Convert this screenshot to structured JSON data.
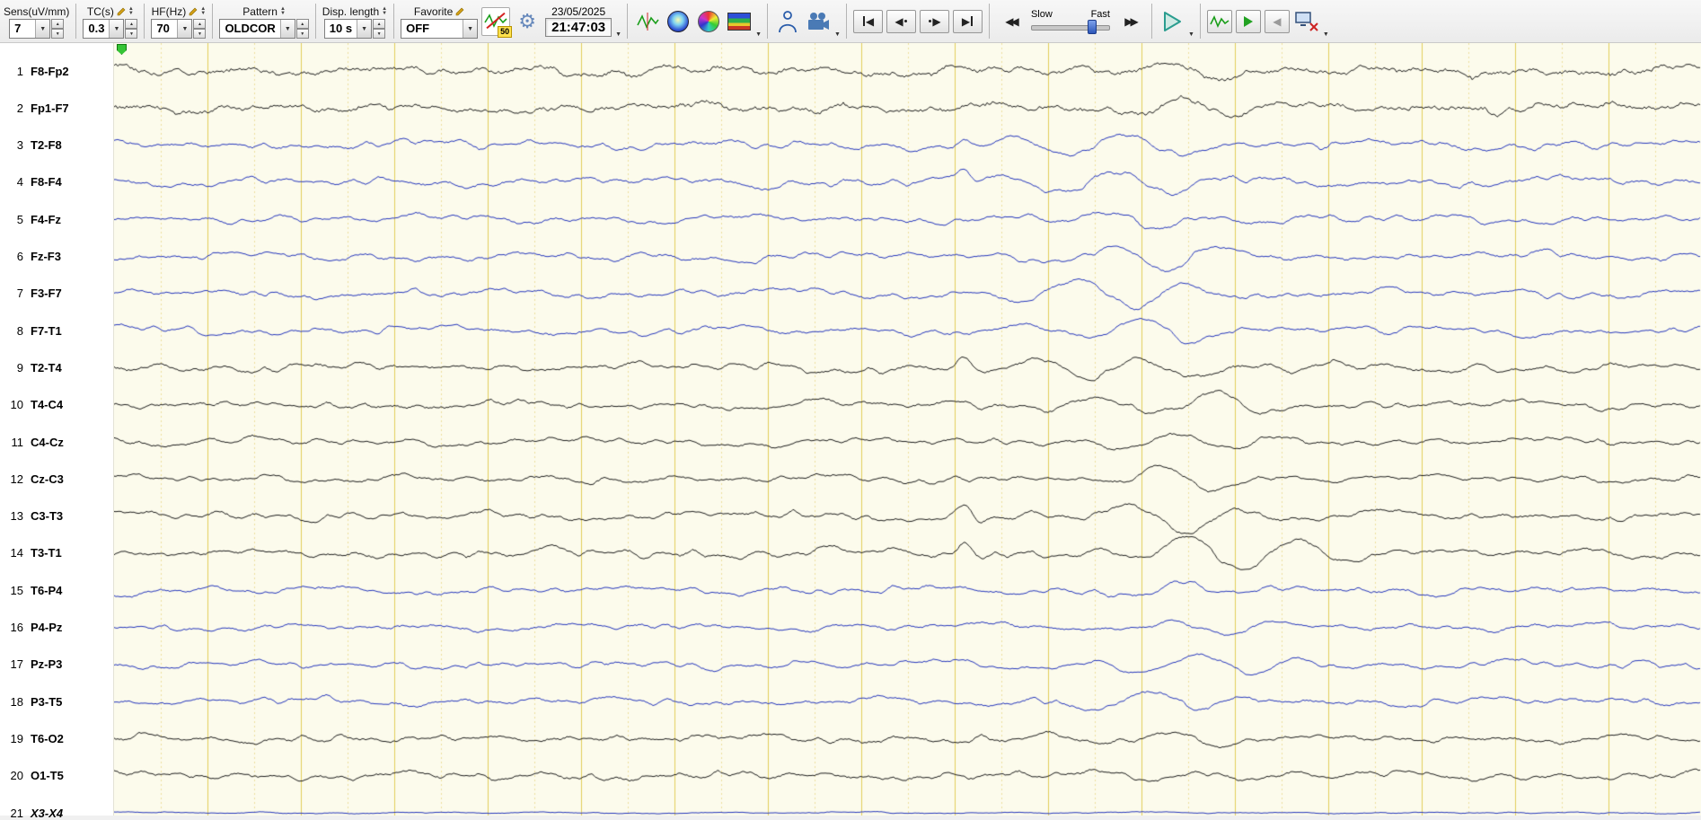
{
  "toolbar": {
    "groups": [
      {
        "label": "Sens(uV/mm)",
        "value": "7"
      },
      {
        "label": "TC(s)",
        "value": "0.3"
      },
      {
        "label": "HF(Hz)",
        "value": "70"
      },
      {
        "label": "Pattern",
        "value": "OLDCOR"
      },
      {
        "label": "Disp. length",
        "value": "10 s"
      },
      {
        "label": "Favorite",
        "value": "OFF"
      }
    ],
    "notch_badge": "50",
    "date": "23/05/2025",
    "time": "21:47:03",
    "slow_label": "Slow",
    "fast_label": "Fast"
  },
  "channels": [
    {
      "num": "1",
      "label": "F8-Fp2",
      "color": "#1b1b1b",
      "amp": 4.5,
      "jitter": 3.0,
      "event_amp": 9,
      "event_center": 0.67,
      "event_width": 0.05,
      "spike": 0
    },
    {
      "num": "2",
      "label": "Fp1-F7",
      "color": "#1b1b1b",
      "amp": 4.5,
      "jitter": 3.0,
      "event_amp": 11,
      "event_center": 0.68,
      "event_width": 0.05,
      "spike": 0
    },
    {
      "num": "3",
      "label": "T2-F8",
      "color": "#2334bb",
      "amp": 4.5,
      "jitter": 1.6,
      "event_amp": 12,
      "event_center": 0.62,
      "event_width": 0.07,
      "spike": 10
    },
    {
      "num": "4",
      "label": "F8-F4",
      "color": "#2334bb",
      "amp": 4.5,
      "jitter": 1.6,
      "event_amp": 12,
      "event_center": 0.63,
      "event_width": 0.07,
      "spike": 12
    },
    {
      "num": "5",
      "label": "F4-Fz",
      "color": "#2334bb",
      "amp": 4.0,
      "jitter": 1.4,
      "event_amp": 10,
      "event_center": 0.66,
      "event_width": 0.06,
      "spike": 0
    },
    {
      "num": "6",
      "label": "Fz-F3",
      "color": "#2334bb",
      "amp": 4.0,
      "jitter": 1.4,
      "event_amp": 15,
      "event_center": 0.66,
      "event_width": 0.06,
      "spike": 0
    },
    {
      "num": "7",
      "label": "F3-F7",
      "color": "#2334bb",
      "amp": 4.5,
      "jitter": 1.4,
      "event_amp": 16,
      "event_center": 0.64,
      "event_width": 0.07,
      "spike": 0
    },
    {
      "num": "8",
      "label": "F7-T1",
      "color": "#2334bb",
      "amp": 4.0,
      "jitter": 1.4,
      "event_amp": 13,
      "event_center": 0.66,
      "event_width": 0.06,
      "spike": 0
    },
    {
      "num": "9",
      "label": "T2-T4",
      "color": "#1b1b1b",
      "amp": 4.5,
      "jitter": 1.6,
      "event_amp": 13,
      "event_center": 0.64,
      "event_width": 0.07,
      "spike": 11
    },
    {
      "num": "10",
      "label": "T4-C4",
      "color": "#1b1b1b",
      "amp": 4.5,
      "jitter": 1.5,
      "event_amp": 13,
      "event_center": 0.68,
      "event_width": 0.06,
      "spike": 0
    },
    {
      "num": "11",
      "label": "C4-Cz",
      "color": "#1b1b1b",
      "amp": 4.0,
      "jitter": 1.4,
      "event_amp": 11,
      "event_center": 0.68,
      "event_width": 0.055,
      "spike": 0
    },
    {
      "num": "12",
      "label": "Cz-C3",
      "color": "#1b1b1b",
      "amp": 4.0,
      "jitter": 1.4,
      "event_amp": 13,
      "event_center": 0.67,
      "event_width": 0.055,
      "spike": 0
    },
    {
      "num": "13",
      "label": "C3-T3",
      "color": "#1b1b1b",
      "amp": 4.5,
      "jitter": 1.5,
      "event_amp": 15,
      "event_center": 0.66,
      "event_width": 0.06,
      "spike": 9
    },
    {
      "num": "14",
      "label": "T3-T1",
      "color": "#1b1b1b",
      "amp": 4.5,
      "jitter": 1.5,
      "event_amp": 21,
      "event_center": 0.7,
      "event_width": 0.065,
      "spike": 10
    },
    {
      "num": "15",
      "label": "T6-P4",
      "color": "#2334bb",
      "amp": 4.0,
      "jitter": 1.4,
      "event_amp": 9,
      "event_center": 0.68,
      "event_width": 0.055,
      "spike": 0
    },
    {
      "num": "16",
      "label": "P4-Pz",
      "color": "#2334bb",
      "amp": 3.5,
      "jitter": 1.3,
      "event_amp": 8,
      "event_center": 0.68,
      "event_width": 0.055,
      "spike": 0
    },
    {
      "num": "17",
      "label": "Pz-P3",
      "color": "#2334bb",
      "amp": 4.0,
      "jitter": 1.3,
      "event_amp": 12,
      "event_center": 0.7,
      "event_width": 0.06,
      "spike": 0
    },
    {
      "num": "18",
      "label": "P3-T5",
      "color": "#2334bb",
      "amp": 4.0,
      "jitter": 1.4,
      "event_amp": 12,
      "event_center": 0.66,
      "event_width": 0.06,
      "spike": 0
    },
    {
      "num": "19",
      "label": "T6-O2",
      "color": "#1b1b1b",
      "amp": 4.0,
      "jitter": 1.5,
      "event_amp": 8,
      "event_center": 0.68,
      "event_width": 0.055,
      "spike": 0
    },
    {
      "num": "20",
      "label": "O1-T5",
      "color": "#1b1b1b",
      "amp": 4.0,
      "jitter": 1.5,
      "event_amp": 8,
      "event_center": 0.68,
      "event_width": 0.055,
      "spike": 0
    },
    {
      "num": "21",
      "label": "X3-X4",
      "color": "#2334bb",
      "amp": 0.8,
      "jitter": 0.5,
      "event_amp": 0,
      "event_center": 0.5,
      "event_width": 0.05,
      "spike": 0,
      "italic": true
    }
  ]
}
